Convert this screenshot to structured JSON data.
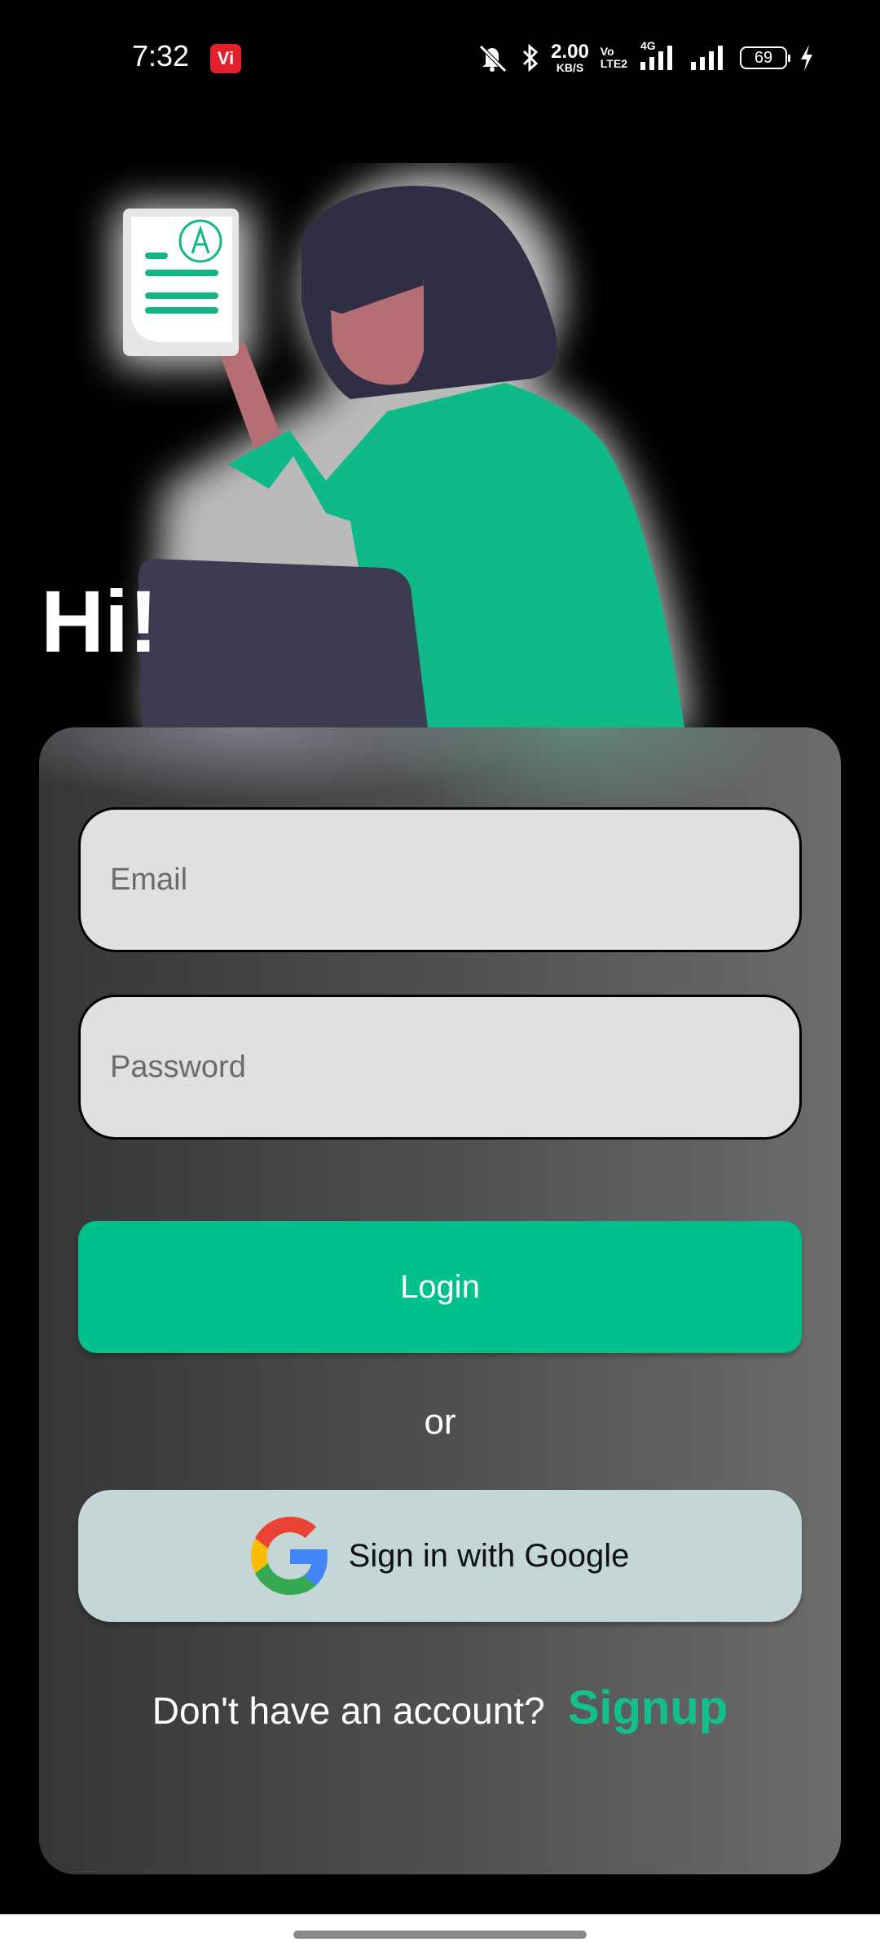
{
  "status_bar": {
    "time": "7:32",
    "carrier_badge": "Vi",
    "net_speed_value": "2.00",
    "net_speed_unit": "KB/S",
    "volte_top": "Vo",
    "volte_bottom": "LTE2",
    "network_type": "4G",
    "battery_level": "69",
    "icons": [
      "mute-icon",
      "bluetooth-icon",
      "signal-icon",
      "signal-icon",
      "charging-icon"
    ]
  },
  "greeting": "Hi!",
  "login_form": {
    "email_placeholder": "Email",
    "password_placeholder": "Password",
    "login_label": "Login",
    "or_label": "or",
    "google_label": "Sign in with Google",
    "signup_prompt": "Don't have an account?",
    "signup_label": "Signup"
  },
  "colors": {
    "accent": "#00c18b",
    "google_button": "#c4d6d6",
    "field_background": "#e0e0e0",
    "background": "#000000"
  }
}
